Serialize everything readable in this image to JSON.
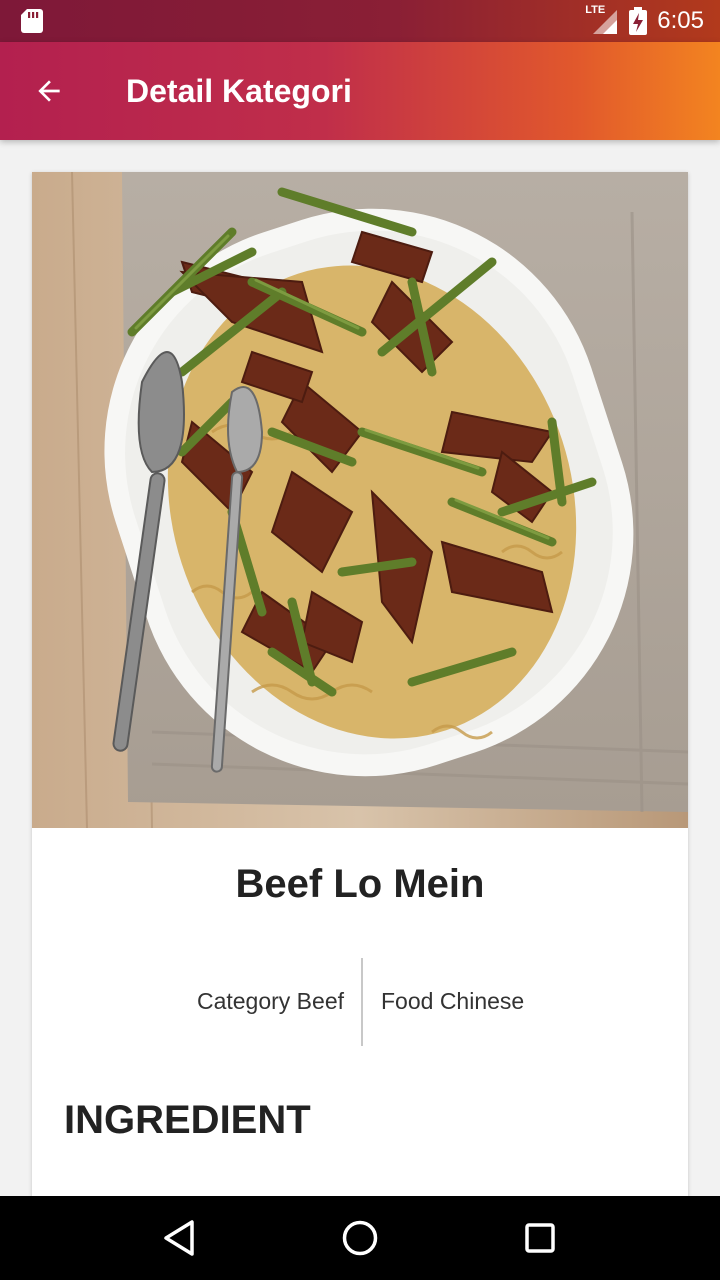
{
  "status_bar": {
    "network_label": "LTE",
    "time": "6:05"
  },
  "app_bar": {
    "title": "Detail Kategori",
    "back_icon": "arrow-back-icon"
  },
  "detail": {
    "name": "Beef Lo Mein",
    "category": "Category Beef",
    "area": "Food Chinese",
    "section_heading": "INGREDIENT"
  },
  "nav_bar": {
    "back_icon": "nav-back-icon",
    "home_icon": "nav-home-icon",
    "recents_icon": "nav-recents-icon"
  },
  "colors": {
    "app_bar_start": "#b3204f",
    "app_bar_end": "#f38420",
    "status_bar": "#7e1838"
  }
}
